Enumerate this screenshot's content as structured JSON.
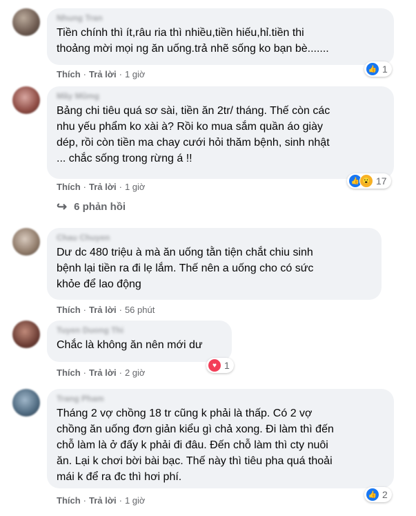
{
  "comments": [
    {
      "author": "Nhung Tran",
      "text": "Tiền chính thì ít,râu ria thì nhiều,tiền hiếu,hỉ.tiền thi\nthoảng mời mọi ng ăn uống.trả nhẽ sống ko bạn bè.......",
      "like_label": "Thích",
      "reply_label": "Trả lời",
      "time": "1 giờ",
      "reaction_count": "1"
    },
    {
      "author": "Mãy Mũmg",
      "text": "Bảng chi tiêu quá sơ sài, tiền ăn 2tr/ tháng. Thế còn các\nnhu yếu phẩm ko xài à? Rồi ko mua sắm quần áo giày\ndép, rồi còn tiền ma chay cưới hỏi thăm bệnh, sinh nhật\n... chắc sống trong rừng á !!",
      "like_label": "Thích",
      "reply_label": "Trả lời",
      "time": "1 giờ",
      "reaction_count": "17"
    },
    {
      "author": "Chau Chuyen",
      "text": "Dư dc 480 triệu à mà ăn uống tằn tiện chắt chiu sinh\nbệnh lại tiền ra đi lẹ lắm. Thế nên a uống cho có sức\nkhỏe để lao động",
      "like_label": "Thích",
      "reply_label": "Trả lời",
      "time": "56 phút"
    },
    {
      "author": "Tuyen Duong Thi",
      "text": "Chắc là không ăn nên mới dư",
      "like_label": "Thích",
      "reply_label": "Trả lời",
      "time": "2 giờ",
      "reaction_count": "1"
    },
    {
      "author": "Trang Pham",
      "text": "Tháng 2 vợ chồng 18 tr cũng k phải là thấp. Có 2 vợ\nchồng ăn uống đơn giản kiểu gì chả xong. Đi làm thì đến\nchỗ làm là ở đấy k phải đi đâu. Đến chỗ làm thì cty nuôi\năn. Lại k chơi bời bài bạc. Thế này thì tiêu pha quá thoải\nmái k để ra đc thì hơi phí.",
      "like_label": "Thích",
      "reply_label": "Trả lời",
      "time": "1 giờ",
      "reaction_count": "2"
    }
  ],
  "replies_link": "6 phản hồi",
  "colors": {
    "like": "#1877f2",
    "love": "#f33e58",
    "wow": "#f7b125",
    "bubble": "#f0f2f5",
    "meta": "#65676b"
  },
  "icons": [
    "like-icon",
    "love-icon",
    "wow-icon",
    "reply-arrow-icon"
  ]
}
